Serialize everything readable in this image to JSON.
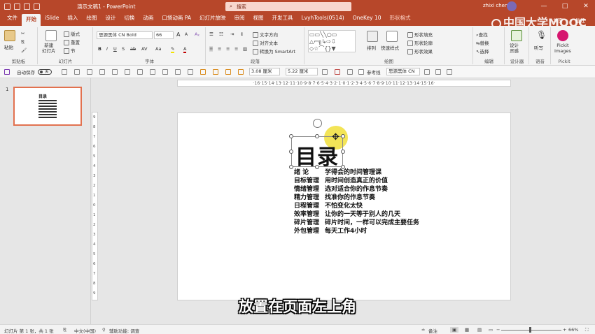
{
  "titlebar": {
    "doc_title": "演示文稿1 - PowerPoint",
    "search_placeholder": "搜索",
    "user_name": "zhixi chen",
    "minimize": "—",
    "restore": "□",
    "close": "✕"
  },
  "watermark": "中国大学MOOC",
  "tabs": [
    {
      "label": "文件"
    },
    {
      "label": "开始"
    },
    {
      "label": "iSlide"
    },
    {
      "label": "插入"
    },
    {
      "label": "绘图"
    },
    {
      "label": "设计"
    },
    {
      "label": "切换"
    },
    {
      "label": "动画"
    },
    {
      "label": "口袋动画 PA"
    },
    {
      "label": "幻灯片放映"
    },
    {
      "label": "审阅"
    },
    {
      "label": "视图"
    },
    {
      "label": "开发工具"
    },
    {
      "label": "LvyhTools(0514)"
    },
    {
      "label": "OneKey 10"
    },
    {
      "label": "形状格式"
    }
  ],
  "tab_share": "共享",
  "tab_comment": "批注",
  "ribbon": {
    "clipboard": {
      "label": "剪贴板",
      "paste": "粘贴"
    },
    "slides": {
      "label": "幻灯片",
      "new_slide": "新建\n幻灯片",
      "layout": "版式",
      "reset": "重置",
      "section": "节"
    },
    "font": {
      "label": "字体",
      "font_name": "思源黑体 CN Bold",
      "font_size": "66",
      "grow": "A",
      "shrink": "A"
    },
    "paragraph": {
      "label": "段落",
      "text_direction": "文字方向",
      "align_text": "对齐文本",
      "smartart": "转换为 SmartArt"
    },
    "drawing": {
      "label": "绘图",
      "arrange": "排列",
      "quick_styles": "快速样式",
      "fill": "形状填充",
      "outline": "形状轮廓",
      "effects": "形状效果"
    },
    "editing": {
      "label": "编辑",
      "find": "查找",
      "replace": "替换",
      "select": "选择"
    },
    "designer": {
      "label": "设计器",
      "ideas": "设计\n灵感"
    },
    "voice": {
      "label": "语音",
      "dictate": "听写"
    },
    "pickit": {
      "label": "Pickit",
      "images": "Pickit\nImages"
    }
  },
  "toolbar2": {
    "autosave": "自动保存",
    "autosave_state": "关",
    "width": "3.08 厘米",
    "height": "5.22 厘米",
    "reference_line": "参考线",
    "font_name": "思源黑体 CN"
  },
  "ruler_h": "·16·15·14·13·12·11·10·9·8·7·6·5·4·3·2·1·0·1·2·3·4·5·6·7·8·9·10·11·12·13·14·15·16·",
  "ruler_v": [
    "9",
    "8",
    "7",
    "6",
    "5",
    "4",
    "3",
    "2",
    "1",
    "0",
    "1",
    "2",
    "3",
    "4",
    "5",
    "6",
    "7",
    "8",
    "9"
  ],
  "thumbnail": {
    "number": "1",
    "title": "目录"
  },
  "slide": {
    "title": "目录",
    "toc": [
      {
        "key": "绪    论",
        "value": "学得会的时间管理课"
      },
      {
        "key": "目标管理",
        "value": "用时间创造真正的价值"
      },
      {
        "key": "情绪管理",
        "value": "选对适合你的作息节奏"
      },
      {
        "key": "精力管理",
        "value": "找准你的作息节奏"
      },
      {
        "key": "日程管理",
        "value": "不怕变化太快"
      },
      {
        "key": "效率管理",
        "value": "让你的一天等于别人的几天"
      },
      {
        "key": "碎片管理",
        "value": "碎片时间，一样可以完成主要任务"
      },
      {
        "key": "外包管理",
        "value": "每天工作4小时"
      }
    ]
  },
  "subtitle": "放置在页面左上角",
  "statusbar": {
    "slide_info": "幻灯片 第 1 张，共 1 张",
    "language": "中文(中国)",
    "accessibility": "辅助功能: 调查",
    "notes": "备注",
    "zoom": "66%"
  },
  "colors": {
    "accent": "#b7472a",
    "highlight": "#f0dc28"
  }
}
